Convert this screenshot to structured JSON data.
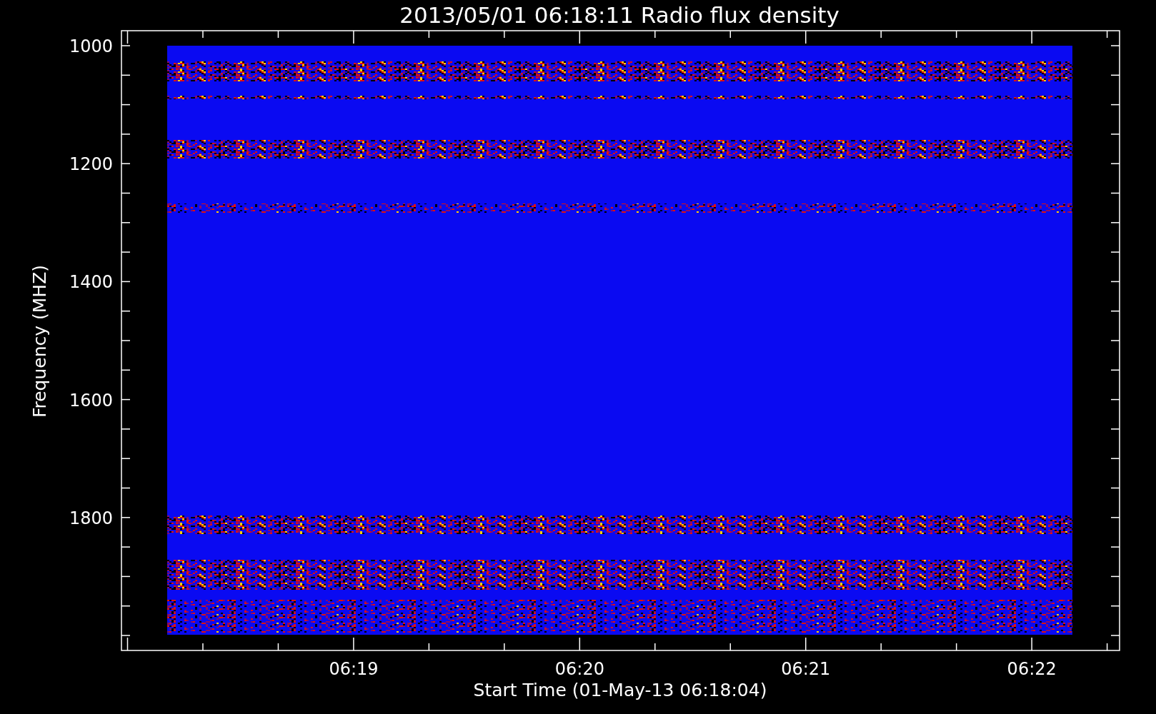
{
  "chart": {
    "title": "2013/05/01 06:18:11 Radio flux density",
    "y_axis": {
      "label": "Frequency (MHZ)",
      "ticks": [
        "1000",
        "1200",
        "1400",
        "1600",
        "1800"
      ]
    },
    "x_axis": {
      "label": "Start Time (01-May-13 06:18:04)",
      "ticks": [
        "06:19",
        "06:20",
        "06:21",
        "06:22"
      ]
    }
  }
}
